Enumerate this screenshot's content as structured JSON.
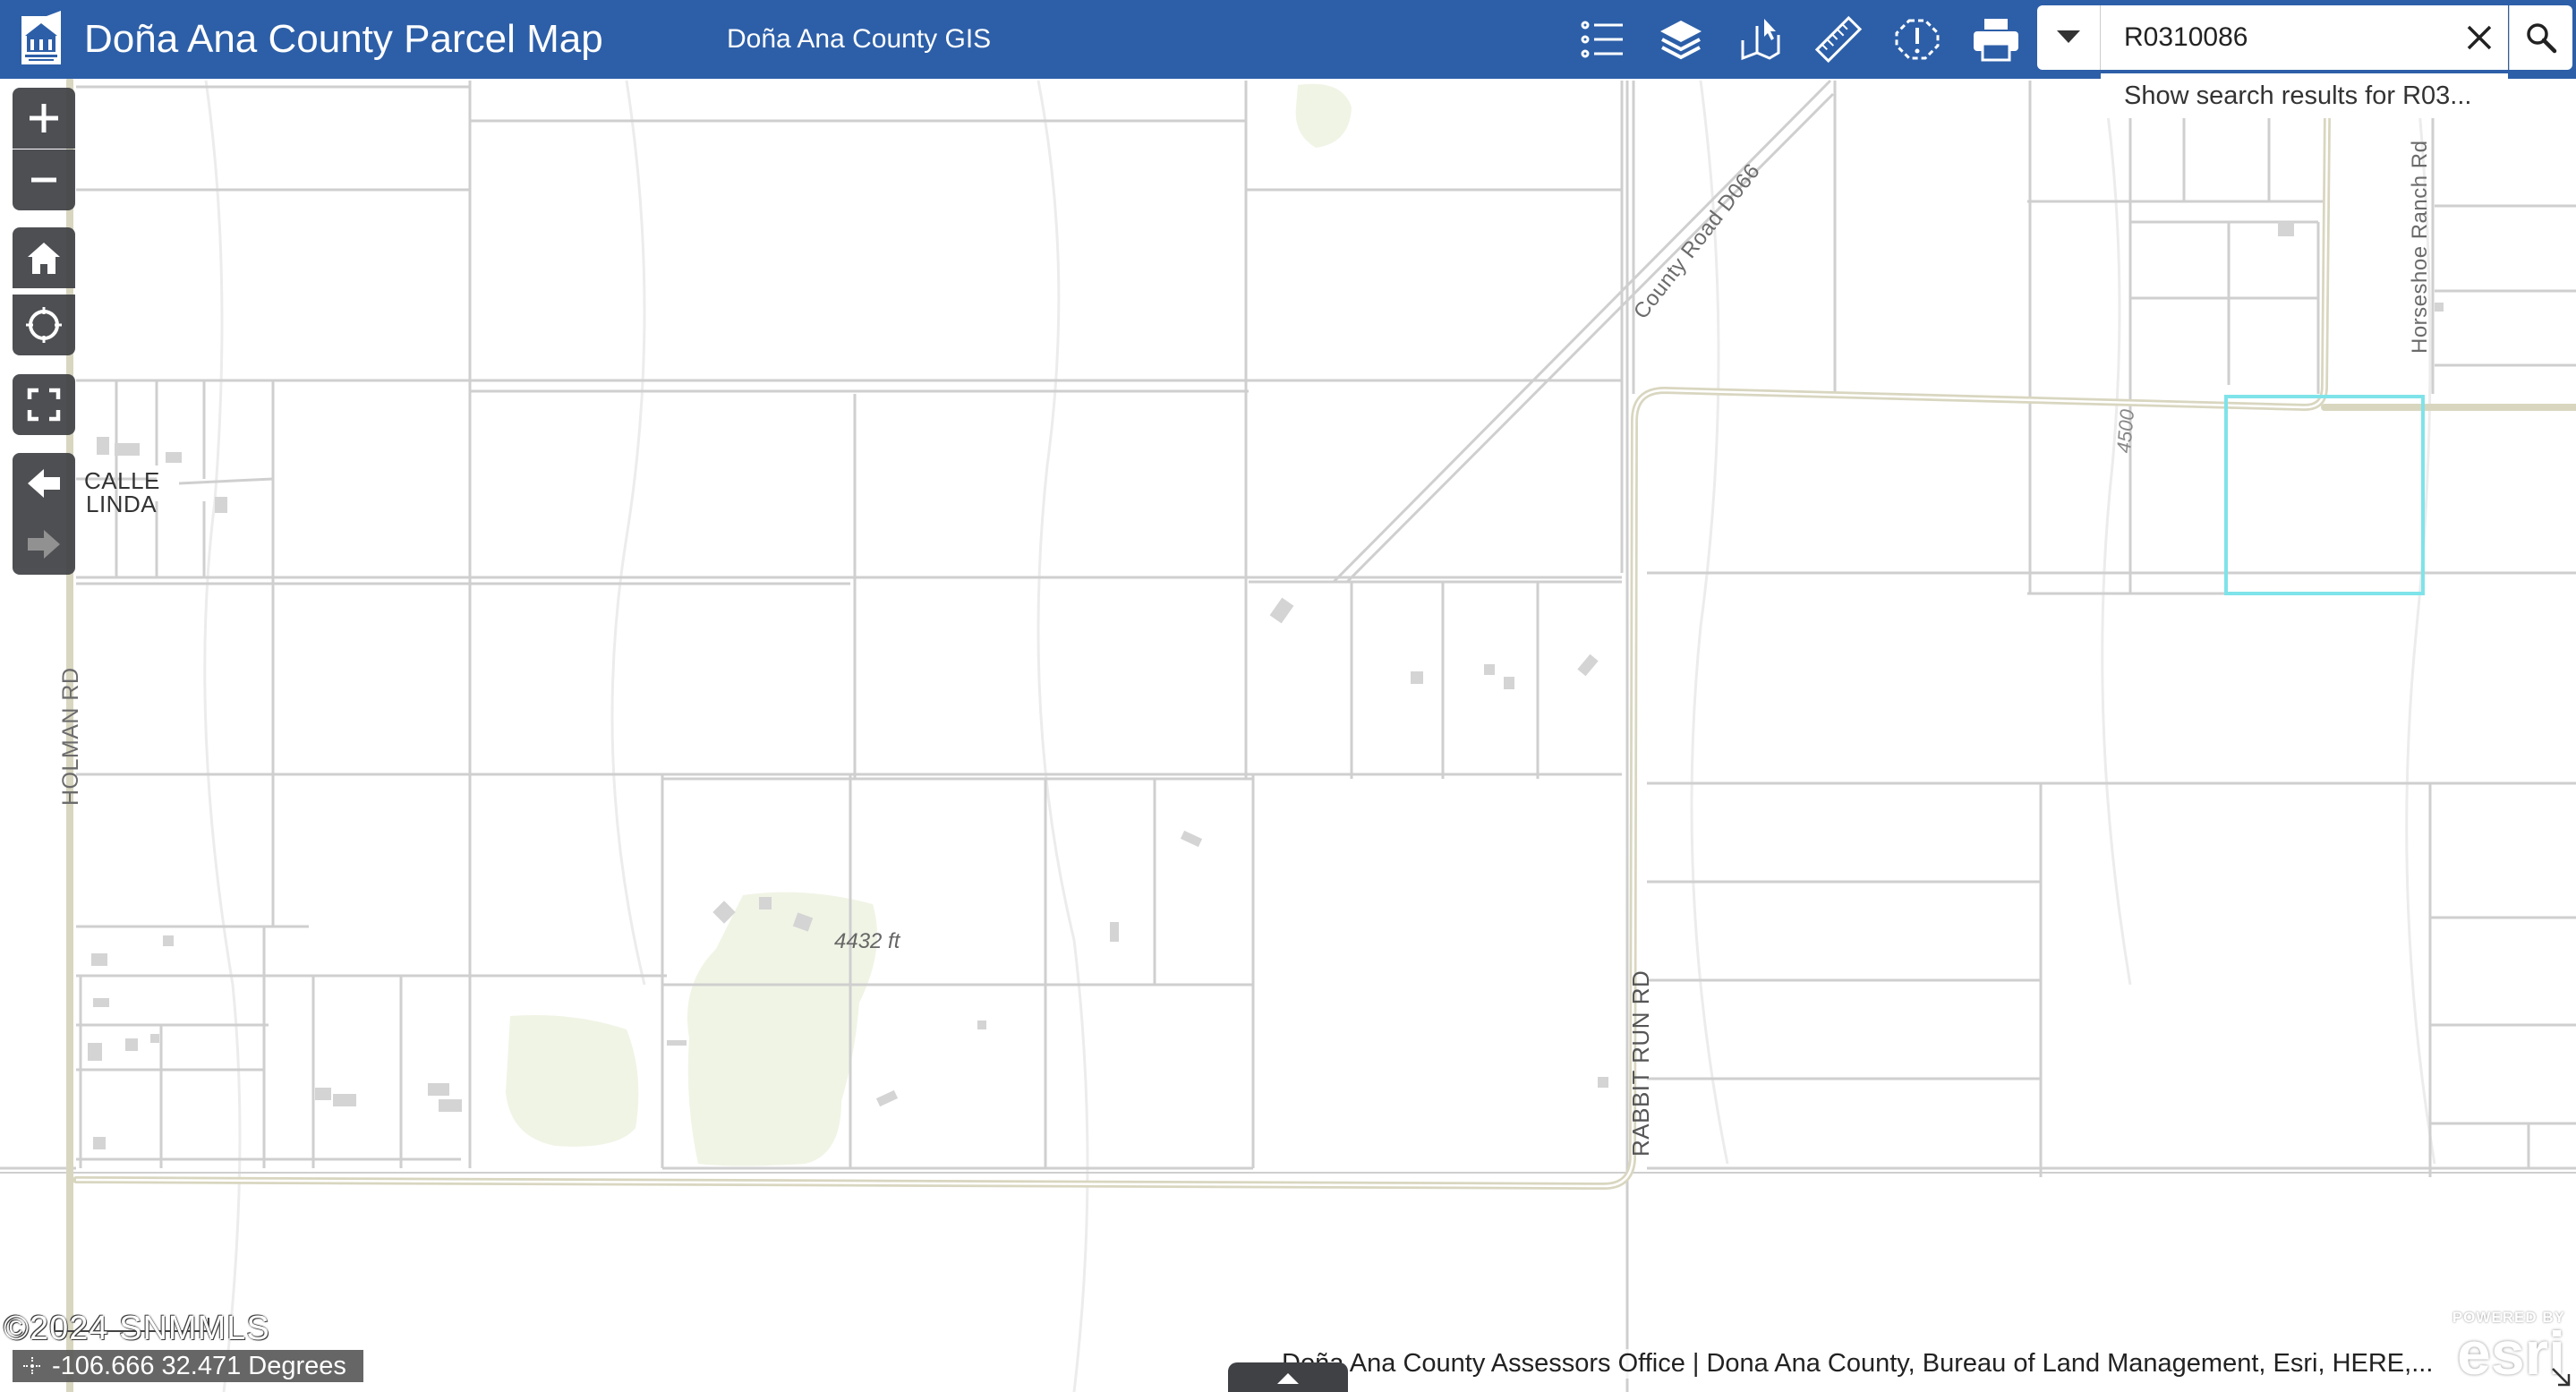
{
  "header": {
    "title": "Doña Ana County Parcel Map",
    "subtitle": "Doña Ana County GIS",
    "bg_color": "#2d5fa8",
    "tools": [
      {
        "name": "legend-icon"
      },
      {
        "name": "layers-icon"
      },
      {
        "name": "select-parcel-icon"
      },
      {
        "name": "measure-icon"
      },
      {
        "name": "report-issue-icon"
      },
      {
        "name": "print-icon"
      }
    ]
  },
  "search": {
    "value": "R0310086",
    "suggestion": "Show search results for R03..."
  },
  "map": {
    "labels": {
      "calle": "CALLE",
      "linda": "LINDA",
      "holman": "HOLMAN RD",
      "county_road": "County Road D066",
      "horseshoe": "Horseshoe Ranch Rd",
      "rabbit_run": "RABBIT RUN RD",
      "elev_4432": "4432 ft",
      "elev_4500": "4500"
    },
    "selected_parcel_color": "#7fe3ea",
    "parcel_line_color": "#cfcfcf",
    "road_color": "#d9d6c0"
  },
  "footer": {
    "copyright": "©2024 SNMMLS",
    "coords": "-106.666 32.471 Degrees",
    "attribution": "Doña Ana County Assessors Office | Dona Ana County, Bureau of Land Management, Esri, HERE,...",
    "esri_powered": "POWERED BY",
    "esri_name": "esri"
  }
}
